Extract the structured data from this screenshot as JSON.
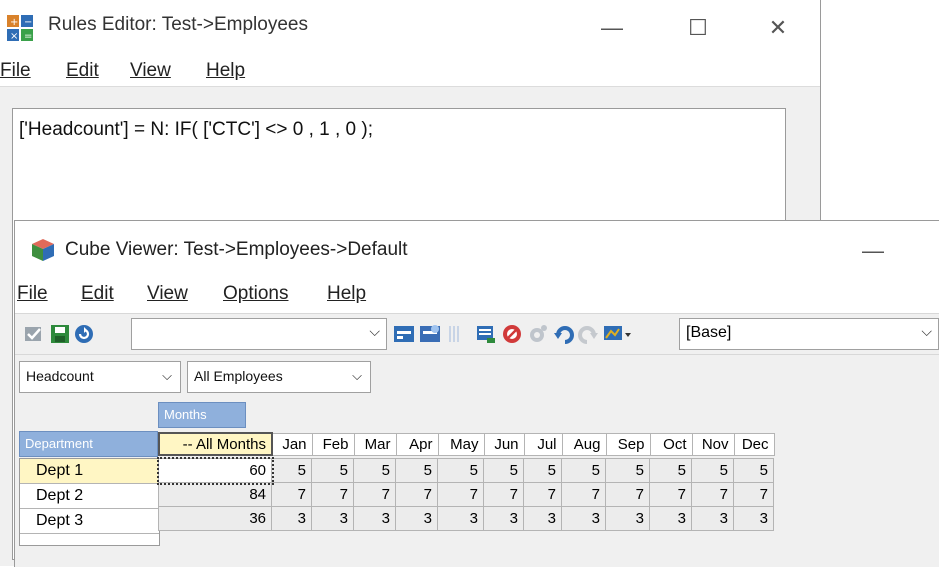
{
  "rules_editor": {
    "title": "Rules Editor:  Test->Employees",
    "menu": [
      "File",
      "Edit",
      "View",
      "Help"
    ],
    "code": "['Headcount'] = N: IF( ['CTC'] <> 0 , 1 , 0 );",
    "caption_minimize": "—",
    "caption_maximize": "☐",
    "caption_close": "✕"
  },
  "cube_viewer": {
    "title": "Cube Viewer: Test->Employees->Default",
    "caption_minimize": "—",
    "menu": [
      "File",
      "Edit",
      "View",
      "Options",
      "Help"
    ],
    "toolbar": {
      "view_select": "",
      "subset_select": "[Base]"
    },
    "title_dims": [
      {
        "value": "Headcount"
      },
      {
        "value": "All Employees"
      }
    ],
    "column_dim_label": "Months",
    "row_dim_label": "Department",
    "columns": [
      "-- All Months",
      "Jan",
      "Feb",
      "Mar",
      "Apr",
      "May",
      "Jun",
      "Jul",
      "Aug",
      "Sep",
      "Oct",
      "Nov",
      "Dec"
    ],
    "rows": [
      {
        "label": "Dept 1",
        "values": [
          "60",
          "5",
          "5",
          "5",
          "5",
          "5",
          "5",
          "5",
          "5",
          "5",
          "5",
          "5",
          "5"
        ]
      },
      {
        "label": "Dept 2",
        "values": [
          "84",
          "7",
          "7",
          "7",
          "7",
          "7",
          "7",
          "7",
          "7",
          "7",
          "7",
          "7",
          "7"
        ]
      },
      {
        "label": "Dept 3",
        "values": [
          "36",
          "3",
          "3",
          "3",
          "3",
          "3",
          "3",
          "3",
          "3",
          "3",
          "3",
          "3",
          "3"
        ]
      }
    ]
  },
  "colors": {
    "accent_header": "#8fb0dc",
    "selected_row": "#fff6c4",
    "data_cell_bg": "#ececec"
  }
}
